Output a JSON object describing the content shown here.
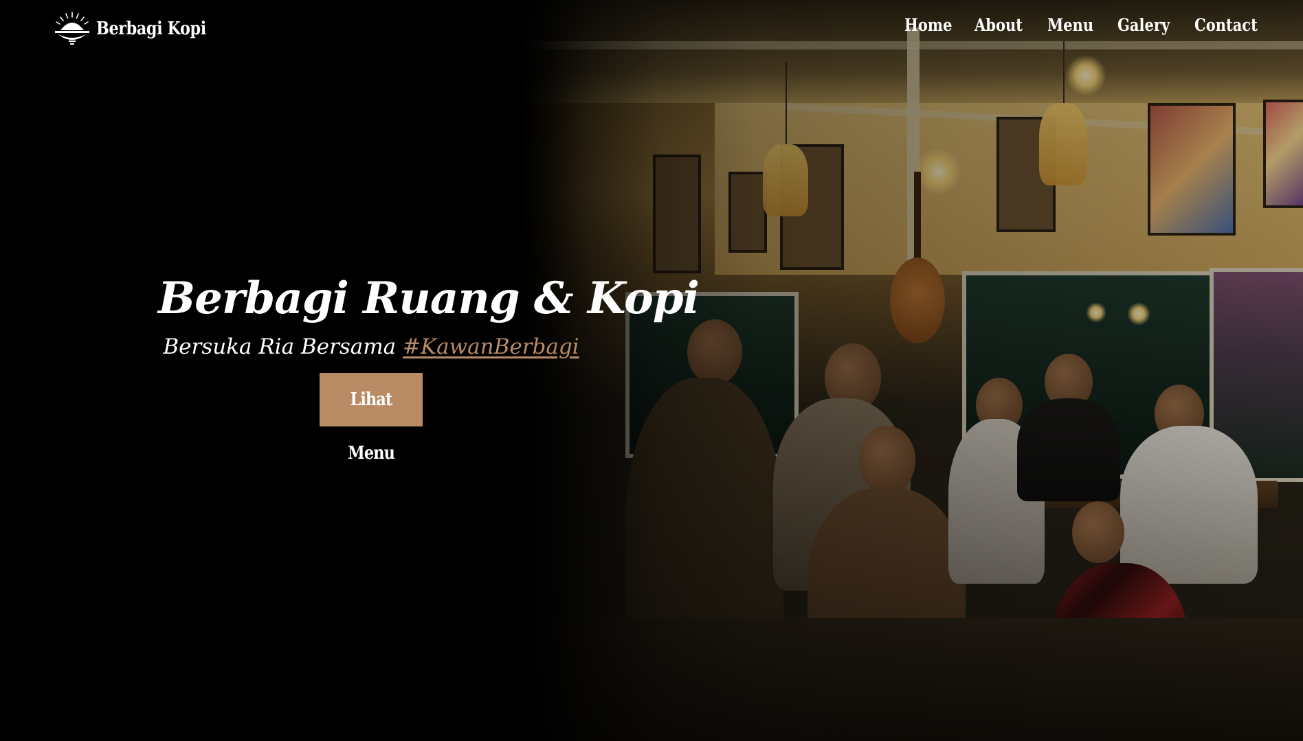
{
  "brand": {
    "name": "Berbagi Kopi",
    "logo_icon": "sunrise-logo-icon"
  },
  "nav": {
    "items": [
      {
        "label": "Home"
      },
      {
        "label": "About"
      },
      {
        "label": "Menu"
      },
      {
        "label": "Galery"
      },
      {
        "label": "Contact"
      }
    ]
  },
  "hero": {
    "title": "Berbagi Ruang & Kopi",
    "subtitle_prefix": "Bersuka Ria Bersama ",
    "hashtag": "#KawanBerbagi",
    "cta_label": "Lihat Menu",
    "background_image": "cafe-interior-photo"
  },
  "colors": {
    "accent": "#b98b65",
    "text": "#ffffff",
    "background": "#000000"
  }
}
